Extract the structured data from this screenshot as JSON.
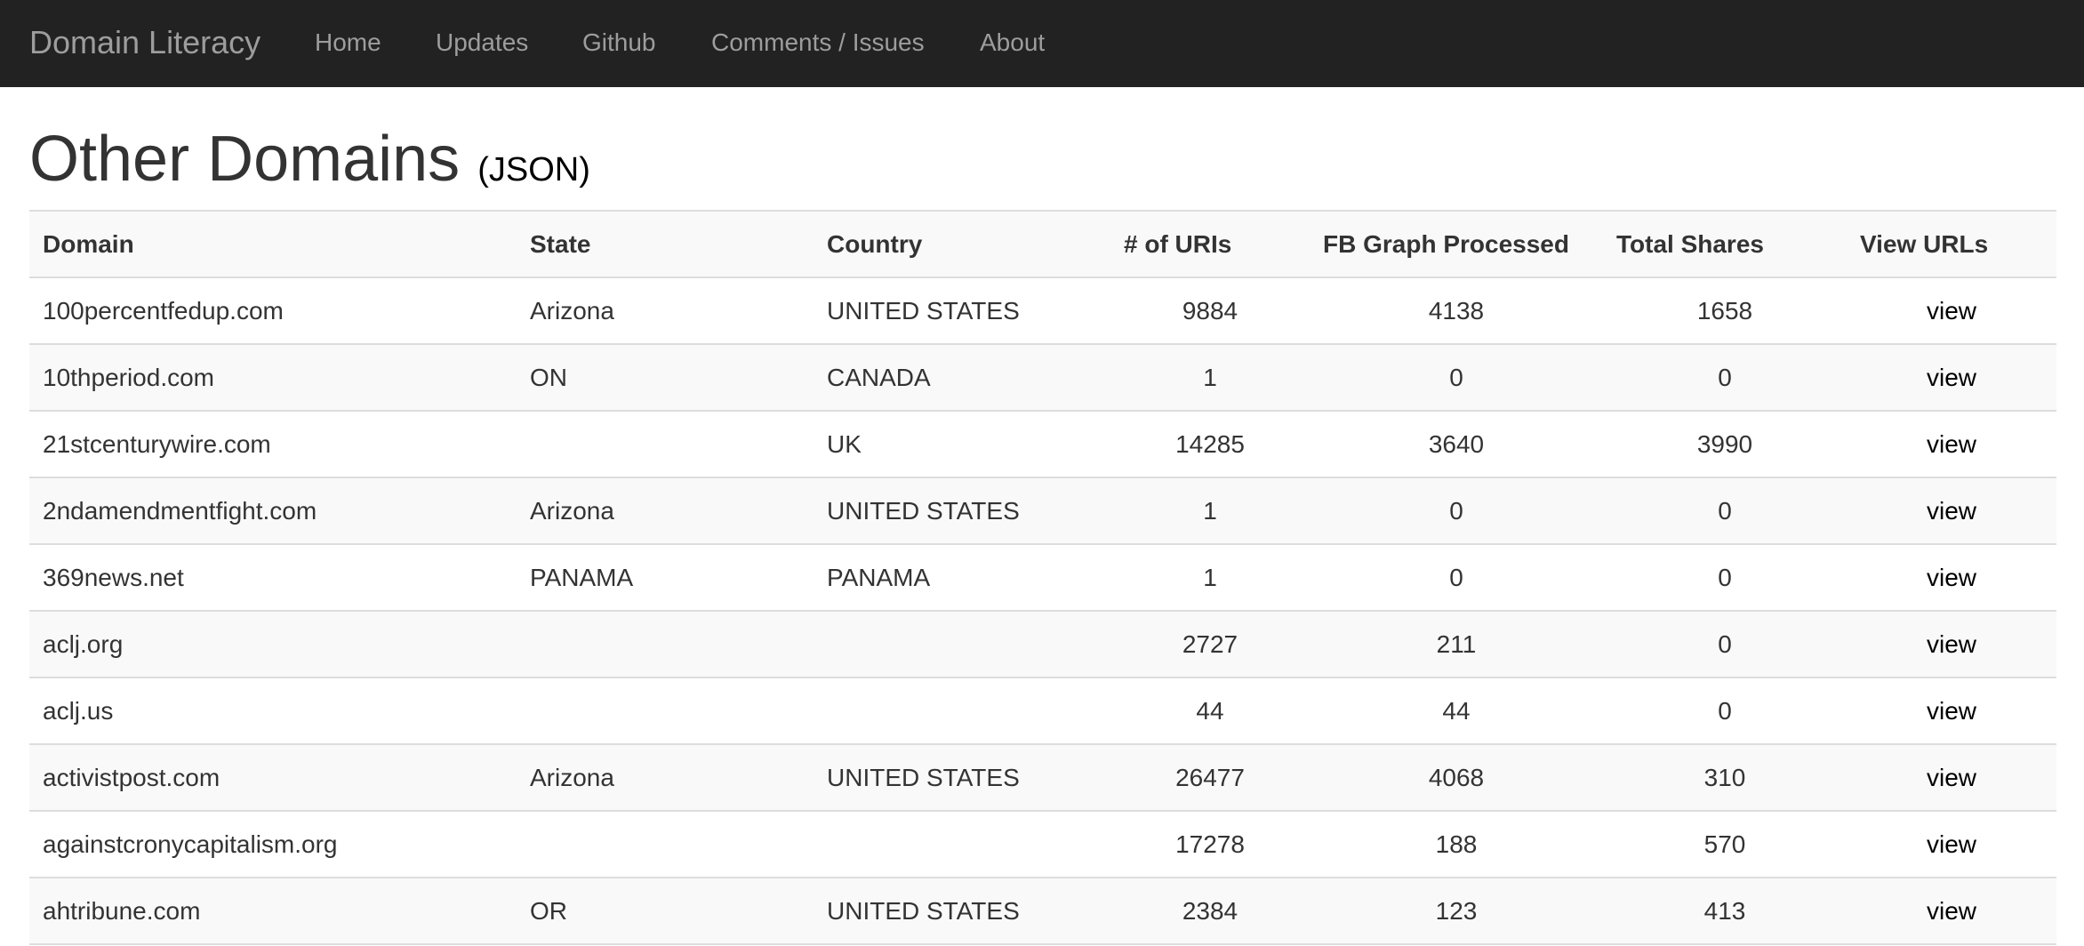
{
  "navbar": {
    "brand": "Domain Literacy",
    "items": [
      {
        "label": "Home"
      },
      {
        "label": "Updates"
      },
      {
        "label": "Github"
      },
      {
        "label": "Comments / Issues"
      },
      {
        "label": "About"
      }
    ]
  },
  "page": {
    "title": "Other Domains",
    "json_link": "(JSON)"
  },
  "table": {
    "headers": {
      "domain": "Domain",
      "state": "State",
      "country": "Country",
      "uris": "# of URIs",
      "fb": "FB Graph Processed",
      "shares": "Total Shares",
      "view": "View URLs"
    },
    "rows": [
      {
        "domain": "100percentfedup.com",
        "state": "Arizona",
        "country": "UNITED STATES",
        "uris": "9884",
        "fb": "4138",
        "shares": "1658",
        "view": "view"
      },
      {
        "domain": "10thperiod.com",
        "state": "ON",
        "country": "CANADA",
        "uris": "1",
        "fb": "0",
        "shares": "0",
        "view": "view"
      },
      {
        "domain": "21stcenturywire.com",
        "state": "",
        "country": "UK",
        "uris": "14285",
        "fb": "3640",
        "shares": "3990",
        "view": "view"
      },
      {
        "domain": "2ndamendmentfight.com",
        "state": "Arizona",
        "country": "UNITED STATES",
        "uris": "1",
        "fb": "0",
        "shares": "0",
        "view": "view"
      },
      {
        "domain": "369news.net",
        "state": "PANAMA",
        "country": "PANAMA",
        "uris": "1",
        "fb": "0",
        "shares": "0",
        "view": "view"
      },
      {
        "domain": "aclj.org",
        "state": "",
        "country": "",
        "uris": "2727",
        "fb": "211",
        "shares": "0",
        "view": "view"
      },
      {
        "domain": "aclj.us",
        "state": "",
        "country": "",
        "uris": "44",
        "fb": "44",
        "shares": "0",
        "view": "view"
      },
      {
        "domain": "activistpost.com",
        "state": "Arizona",
        "country": "UNITED STATES",
        "uris": "26477",
        "fb": "4068",
        "shares": "310",
        "view": "view"
      },
      {
        "domain": "againstcronycapitalism.org",
        "state": "",
        "country": "",
        "uris": "17278",
        "fb": "188",
        "shares": "570",
        "view": "view"
      },
      {
        "domain": "ahtribune.com",
        "state": "OR",
        "country": "UNITED STATES",
        "uris": "2384",
        "fb": "123",
        "shares": "413",
        "view": "view"
      }
    ]
  }
}
